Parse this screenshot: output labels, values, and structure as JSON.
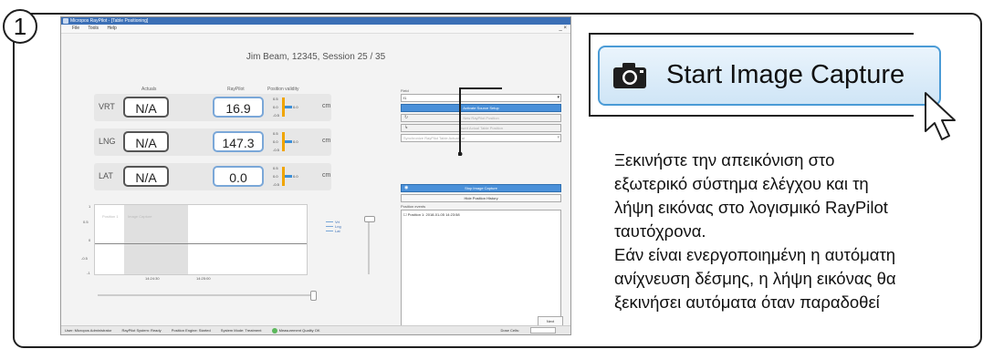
{
  "step_number": "1",
  "app": {
    "title": "Micropos RayPilot - [Table Positioning]",
    "menu": [
      "File",
      "Tools",
      "Help"
    ],
    "window_controls": "_ ×",
    "session": "Jim Beam, 12345, Session 25 / 35",
    "columns": {
      "actuals": "Actuals",
      "raypilot": "RayPilot",
      "validity": "Position validity"
    },
    "rows": [
      {
        "label": "VRT",
        "actual": "N/A",
        "raypilot": "16.9",
        "unit": "cm",
        "validity_top": "0.5",
        "validity_mid": "0.0",
        "validity_bot": "-0.5",
        "validity_val": "0.0"
      },
      {
        "label": "LNG",
        "actual": "N/A",
        "raypilot": "147.3",
        "unit": "cm",
        "validity_top": "0.5",
        "validity_mid": "0.0",
        "validity_bot": "-0.5",
        "validity_val": "0.0"
      },
      {
        "label": "LAT",
        "actual": "N/A",
        "raypilot": "0.0",
        "unit": "cm",
        "validity_top": "0.5",
        "validity_mid": "0.0",
        "validity_bot": "-0.5",
        "validity_val": "0.0"
      }
    ],
    "graph": {
      "y_ticks": [
        "1",
        "0.5",
        "0",
        "-0.5",
        "-1"
      ],
      "x_ticks": [
        "14:24:30",
        "14:25:00"
      ],
      "shade_labels": [
        "Position 1",
        "Image Capture"
      ],
      "legend": [
        "Vrt",
        "Lng",
        "Lat"
      ]
    },
    "right_panel": {
      "field_label": "Field",
      "field_value": "f1",
      "activate_button": "Activate Source Setup",
      "new_position_button": "New RayPilot Position",
      "insert_position_button": "Insert Actual Table Position",
      "synchronize_select": "Synchronize RayPilot Table Actuals at",
      "stop_capture_button": "Stop Image Capture",
      "hide_history_button": "Hide Position History",
      "events_label": "Position events",
      "events": [
        "Position 1: 2018-01-05 14:23:58"
      ]
    },
    "next_button": "Next",
    "status": {
      "user": "User: Micropos Administrator",
      "system": "RayPilot System: Ready",
      "engine": "Position Engine: Started",
      "mode": "System Mode: Treatment",
      "quality": "Measurement Quality OK",
      "dose": "Dose Cells:"
    }
  },
  "callout": {
    "button_label": "Start Image Capture",
    "icon": "camera-icon"
  },
  "description": [
    "Ξεκινήστε την απεικόνιση στο",
    "εξωτερικό σύστημα ελέγχου και τη",
    "λήψη εικόνας στο λογισμικό RayPilot",
    "ταυτόχρονα.",
    "Εάν είναι ενεργοποιημένη η αυτόματη",
    "ανίχνευση δέσμης, η λήψη εικόνας θα",
    "ξεκινήσει αυτόματα όταν παραδοθεί"
  ],
  "colors": {
    "accent": "#4a9bd6",
    "validity_bar": "#f0a500",
    "titlebar": "#3b6fb6"
  }
}
